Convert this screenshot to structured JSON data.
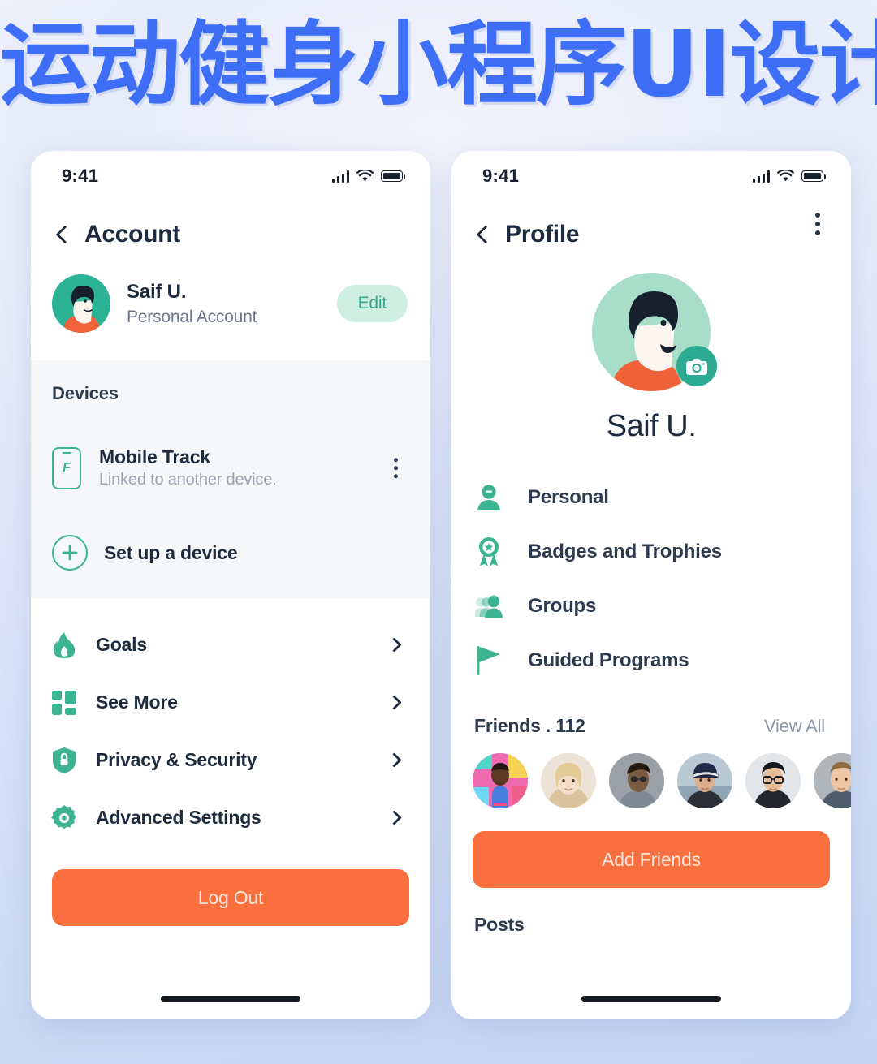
{
  "page": {
    "title": "运动健身小程序UI设计",
    "title_color": "#3d6ef5",
    "background_colors": [
      "#eef1fb",
      "#c6d6f4"
    ]
  },
  "theme": {
    "accent_green": "#3cb391",
    "accent_orange": "#f9703e",
    "text_dark": "#1d2b3e",
    "text_muted": "#9aa3b0",
    "pill_mint": "#cdeee0"
  },
  "account_screen": {
    "statusbar": {
      "time": "9:41",
      "icons": [
        "signal-icon",
        "wifi-icon",
        "battery-icon"
      ]
    },
    "nav": {
      "back_icon": "chevron-left-icon",
      "title": "Account"
    },
    "account": {
      "avatar": "user-avatar-illustration",
      "name": "Saif U.",
      "subtitle": "Personal Account",
      "edit_label": "Edit"
    },
    "devices": {
      "section_label": "Devices",
      "device": {
        "icon": "mobile-phone-icon",
        "title": "Mobile Track",
        "subtitle": "Linked to another device.",
        "menu_icon": "kebab-menu-icon"
      },
      "setup": {
        "icon": "plus-circle-icon",
        "label": "Set up a device"
      }
    },
    "menu_items": [
      {
        "icon": "flame-icon",
        "label": "Goals",
        "chevron": "chevron-right-icon"
      },
      {
        "icon": "grid-icon",
        "label": "See More",
        "chevron": "chevron-right-icon"
      },
      {
        "icon": "shield-lock-icon",
        "label": "Privacy & Security",
        "chevron": "chevron-right-icon"
      },
      {
        "icon": "gear-icon",
        "label": "Advanced Settings",
        "chevron": "chevron-right-icon"
      }
    ],
    "logout_label": "Log Out"
  },
  "profile_screen": {
    "statusbar": {
      "time": "9:41",
      "icons": [
        "signal-icon",
        "wifi-icon",
        "battery-icon"
      ]
    },
    "nav": {
      "back_icon": "chevron-left-icon",
      "title": "Profile",
      "menu_icon": "kebab-menu-icon"
    },
    "hero": {
      "avatar": "user-avatar-illustration",
      "camera_badge_icon": "camera-icon",
      "name": "Saif U."
    },
    "menu_items": [
      {
        "icon": "person-icon",
        "label": "Personal"
      },
      {
        "icon": "medal-icon",
        "label": "Badges and Trophies"
      },
      {
        "icon": "group-icon",
        "label": "Groups"
      },
      {
        "icon": "flag-icon",
        "label": "Guided Programs"
      }
    ],
    "friends": {
      "title": "Friends . 112",
      "count": 112,
      "view_all_label": "View All",
      "avatars": [
        {
          "name": "friend-1",
          "bg": "#e84a9a"
        },
        {
          "name": "friend-2",
          "bg": "#e8ddd0"
        },
        {
          "name": "friend-3",
          "bg": "#9aa0a6"
        },
        {
          "name": "friend-4",
          "bg": "#b9c6ce"
        },
        {
          "name": "friend-5",
          "bg": "#dfe2e5"
        },
        {
          "name": "friend-6",
          "bg": "#b4b9bd"
        }
      ]
    },
    "add_friends_label": "Add Friends",
    "posts_label": "Posts"
  }
}
